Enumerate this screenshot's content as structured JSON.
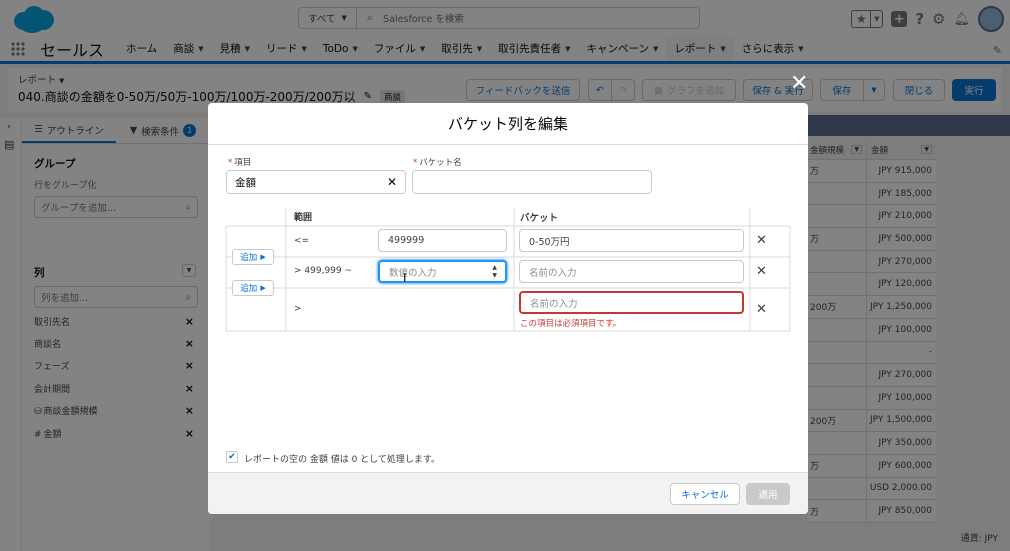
{
  "header": {
    "search_scope": "すべて",
    "search_placeholder": "Salesforce を検索"
  },
  "nav": {
    "app_name": "セールス",
    "items": [
      {
        "label": "ホーム",
        "caret": false
      },
      {
        "label": "商談",
        "caret": true
      },
      {
        "label": "見積",
        "caret": true
      },
      {
        "label": "リード",
        "caret": true
      },
      {
        "label": "ToDo",
        "caret": true
      },
      {
        "label": "ファイル",
        "caret": true
      },
      {
        "label": "取引先",
        "caret": true
      },
      {
        "label": "取引先責任者",
        "caret": true
      },
      {
        "label": "キャンペーン",
        "caret": true
      },
      {
        "label": "レポート",
        "caret": true
      },
      {
        "label": "さらに表示",
        "caret": true
      }
    ]
  },
  "page_header": {
    "object_label": "レポート",
    "title": "040.商談の金額を0-50万/50万-100万/100万-200万/200万以",
    "badge": "商談",
    "feedback_button": "フィードバックを送信",
    "chart_button": "グラフを追加",
    "save_run_button": "保存 & 実行",
    "save_button": "保存",
    "close_button": "閉じる",
    "run_button": "実行"
  },
  "sidebar": {
    "tab_outline": "アウトライン",
    "tab_filters": "検索条件",
    "filter_count": "1",
    "groups_heading": "グループ",
    "group_rows_label": "行をグループ化",
    "group_add_placeholder": "グループを追加...",
    "columns_heading": "列",
    "column_add_placeholder": "列を追加...",
    "columns": [
      "取引先名",
      "商談名",
      "フェーズ",
      "会計期間",
      "商談金額規模",
      "金額"
    ]
  },
  "report_table": {
    "headers": [
      "金額規模",
      "金額"
    ],
    "rows": [
      [
        "万",
        "JPY 915,000"
      ],
      [
        "",
        "JPY 185,000"
      ],
      [
        "",
        "JPY 210,000"
      ],
      [
        "万",
        "JPY 500,000"
      ],
      [
        "",
        "JPY 270,000"
      ],
      [
        "",
        "JPY 120,000"
      ],
      [
        "200万",
        "JPY 1,250,000"
      ],
      [
        "",
        "JPY 100,000"
      ],
      [
        "",
        "-"
      ],
      [
        "",
        "JPY 270,000"
      ],
      [
        "",
        "JPY 100,000"
      ],
      [
        "200万",
        "JPY 1,500,000"
      ],
      [
        "",
        "JPY 350,000"
      ],
      [
        "万",
        "JPY 600,000"
      ],
      [
        "",
        "USD 2,000.00"
      ],
      [
        "万",
        "JPY 850,000"
      ]
    ],
    "currency_footer": "通貨: JPY"
  },
  "modal": {
    "title": "バケット列を編集",
    "field_label": "項目",
    "field_value": "金額",
    "bucket_name_label": "バケット名",
    "bucket_name_value": "",
    "range_header": "範囲",
    "bucket_header": "バケット",
    "add_label": "追加",
    "rows": [
      {
        "operator": "<=",
        "value": "499999",
        "value_placeholder": "",
        "bucket": "0-50万円",
        "bucket_placeholder": ""
      },
      {
        "operator": "> 499,999 ~",
        "value": "",
        "value_placeholder": "数値の入力",
        "bucket": "",
        "bucket_placeholder": "名前の入力"
      },
      {
        "operator": ">",
        "value": "",
        "value_placeholder": "",
        "bucket": "",
        "bucket_placeholder": "名前の入力"
      }
    ],
    "error_text": "この項目は必須項目です。",
    "checkbox_label": "レポートの空の 金額 値は 0 として処理します。",
    "cancel_button": "キャンセル",
    "apply_button": "適用"
  },
  "colors": {
    "brand": "#0070d2",
    "error": "#c23934",
    "nav_band": "#54698d"
  }
}
